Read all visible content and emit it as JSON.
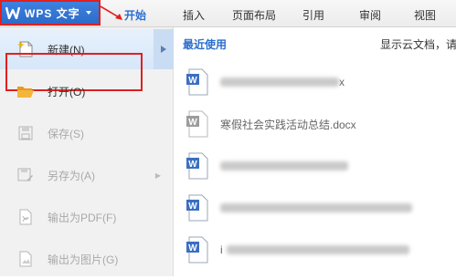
{
  "app": {
    "menu_button_label": "WPS 文字",
    "tabs": [
      "开始",
      "插入",
      "页面布局",
      "引用",
      "审阅",
      "视图"
    ]
  },
  "file_menu": {
    "items": [
      {
        "label": "新建(N)"
      },
      {
        "label": "打开(O)"
      },
      {
        "label": "保存(S)"
      },
      {
        "label": "另存为(A)"
      },
      {
        "label": "输出为PDF(F)"
      },
      {
        "label": "输出为图片(G)"
      }
    ]
  },
  "recent": {
    "title": "最近使用",
    "cloud_text": "显示云文档，请",
    "files": [
      {
        "name": "x"
      },
      {
        "name": "寒假社会实践活动总结.docx"
      },
      {
        "name": ""
      },
      {
        "name": ""
      },
      {
        "name": "i"
      }
    ]
  },
  "colors": {
    "brand_blue": "#2c6bc8",
    "annotation_red": "#e02020",
    "active_tab": "#2a6fd0"
  },
  "icons": {
    "new": "new-document-icon",
    "open": "open-folder-icon",
    "save": "save-icon",
    "save_as": "save-as-icon",
    "export_pdf": "export-pdf-icon",
    "export_image": "export-image-icon",
    "doc": "word-document-icon"
  }
}
